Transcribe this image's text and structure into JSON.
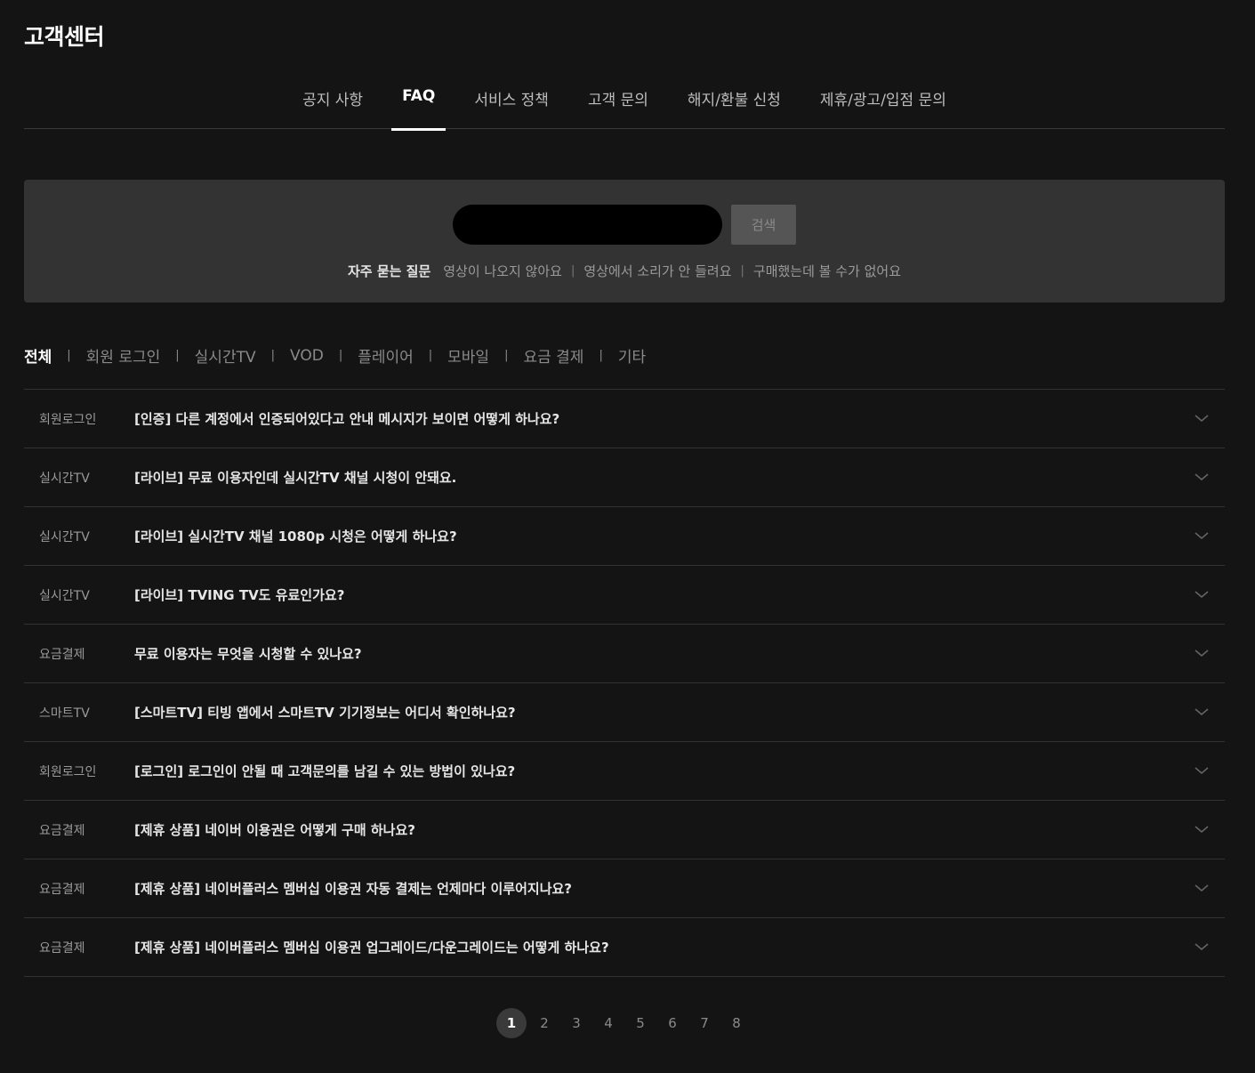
{
  "page_title": "고객센터",
  "tabs": [
    {
      "label": "공지 사항",
      "active": false
    },
    {
      "label": "FAQ",
      "active": true
    },
    {
      "label": "서비스 정책",
      "active": false
    },
    {
      "label": "고객 문의",
      "active": false
    },
    {
      "label": "해지/환불 신청",
      "active": false
    },
    {
      "label": "제휴/광고/입점 문의",
      "active": false
    }
  ],
  "search": {
    "value": "",
    "placeholder": "",
    "button_label": "검색"
  },
  "quick_faq": {
    "title": "자주 묻는 질문",
    "links": [
      "영상이 나오지 않아요",
      "영상에서 소리가 안 들려요",
      "구매했는데 볼 수가 없어요"
    ]
  },
  "categories": [
    {
      "label": "전체",
      "active": true
    },
    {
      "label": "회원 로그인",
      "active": false
    },
    {
      "label": "실시간TV",
      "active": false
    },
    {
      "label": "VOD",
      "active": false
    },
    {
      "label": "플레이어",
      "active": false
    },
    {
      "label": "모바일",
      "active": false
    },
    {
      "label": "요금 결제",
      "active": false
    },
    {
      "label": "기타",
      "active": false
    }
  ],
  "faq_items": [
    {
      "category": "회원로그인",
      "question": "[인증] 다른 계정에서 인증되어있다고 안내 메시지가 보이면 어떻게 하나요?"
    },
    {
      "category": "실시간TV",
      "question": "[라이브] 무료 이용자인데 실시간TV 채널 시청이 안돼요."
    },
    {
      "category": "실시간TV",
      "question": "[라이브] 실시간TV 채널 1080p 시청은 어떻게 하나요?"
    },
    {
      "category": "실시간TV",
      "question": "[라이브] TVING TV도 유료인가요?"
    },
    {
      "category": "요금결제",
      "question": "무료 이용자는 무엇을 시청할 수 있나요?"
    },
    {
      "category": "스마트TV",
      "question": "[스마트TV] 티빙 앱에서 스마트TV 기기정보는 어디서 확인하나요?"
    },
    {
      "category": "회원로그인",
      "question": "[로그인] 로그인이 안될 때 고객문의를 남길 수 있는 방법이 있나요?"
    },
    {
      "category": "요금결제",
      "question": "[제휴 상품] 네이버 이용권은 어떻게 구매 하나요?"
    },
    {
      "category": "요금결제",
      "question": "[제휴 상품] 네이버플러스 멤버십 이용권 자동 결제는 언제마다 이루어지나요?"
    },
    {
      "category": "요금결제",
      "question": "[제휴 상품] 네이버플러스 멤버십 이용권 업그레이드/다운그레이드는 어떻게 하나요?"
    }
  ],
  "pagination": {
    "pages": [
      "1",
      "2",
      "3",
      "4",
      "5",
      "6",
      "7",
      "8"
    ],
    "current": "1"
  },
  "colors": {
    "background": "#141414",
    "panel": "#333333",
    "divider": "#333333",
    "text_primary": "#ffffff",
    "text_secondary": "#9a9a9a"
  },
  "icons": {
    "faq_toggle": "chevron-down-icon"
  }
}
